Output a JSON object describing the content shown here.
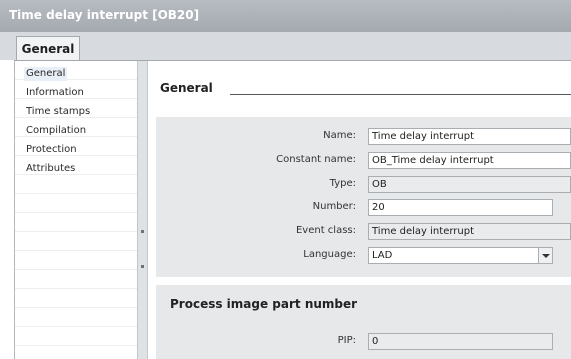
{
  "window": {
    "title": "Time delay interrupt [OB20]"
  },
  "tabs": [
    {
      "label": "General"
    }
  ],
  "nav": {
    "items": [
      {
        "label": "General"
      },
      {
        "label": "Information"
      },
      {
        "label": "Time stamps"
      },
      {
        "label": "Compilation"
      },
      {
        "label": "Protection"
      },
      {
        "label": "Attributes"
      }
    ]
  },
  "general": {
    "heading": "General",
    "fields": {
      "name": {
        "label": "Name:",
        "value": "Time delay interrupt"
      },
      "constant_name": {
        "label": "Constant name:",
        "value": "OB_Time delay interrupt"
      },
      "type": {
        "label": "Type:",
        "value": "OB"
      },
      "number": {
        "label": "Number:",
        "value": "20"
      },
      "event_class": {
        "label": "Event class:",
        "value": "Time delay interrupt"
      },
      "language": {
        "label": "Language:",
        "value": "LAD"
      }
    }
  },
  "process_image": {
    "heading": "Process image part number",
    "pip": {
      "label": "PIP:",
      "value": "0"
    }
  }
}
